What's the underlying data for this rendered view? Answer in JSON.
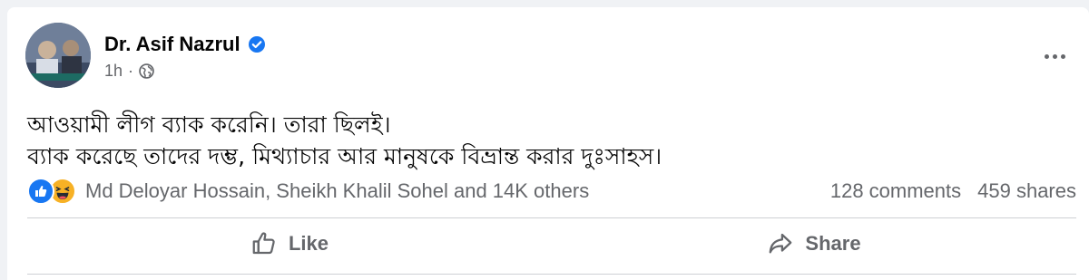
{
  "post": {
    "author": "Dr. Asif Nazrul",
    "time": "1h",
    "separator": "·",
    "lines": [
      "আওয়ামী লীগ ব্যাক করেনি। তারা ছিলই।",
      "ব্যাক করেছে তাদের দম্ভ, মিথ্যাচার আর মানুষকে বিভ্রান্ত করার দুঃসাহস।"
    ]
  },
  "engagement": {
    "reactors": "Md Deloyar Hossain, Sheikh Khalil Sohel and 14K others",
    "comments": "128 comments",
    "shares": "459 shares"
  },
  "actions": {
    "like": "Like",
    "share": "Share"
  },
  "icons": [
    "avatar",
    "verified-badge-icon",
    "globe-icon",
    "more-options-icon",
    "like-reaction-icon",
    "haha-reaction-icon",
    "thumbs-up-icon",
    "share-arrow-icon"
  ],
  "colors": {
    "brand": "#1877f2",
    "secondary_text": "#65676b",
    "primary_text": "#050505",
    "haha": "#f7b125"
  }
}
